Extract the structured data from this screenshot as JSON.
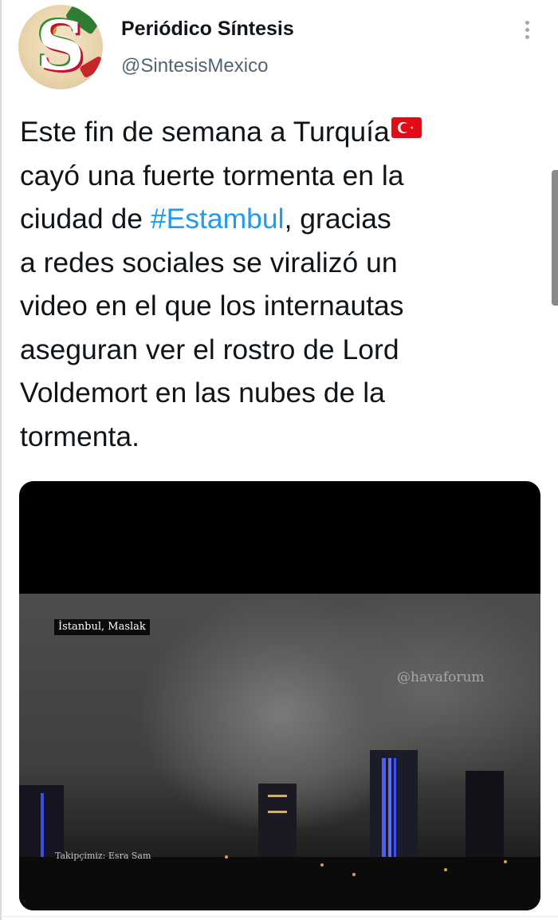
{
  "account": {
    "display_name": "Periódico Síntesis",
    "handle": "@SintesisMexico",
    "avatar_icon": "sintesis-logo-icon"
  },
  "tweet": {
    "line1": "Este fin de semana a Turquía",
    "line2": "cayó una fuerte tormenta en la",
    "line3_prefix": "ciudad de ",
    "hashtag": "#Estambul",
    "line3_suffix": ", gracias",
    "line4": "a redes sociales se viralizó un",
    "line5": "video en el que los internautas",
    "line6": "aseguran ver el rostro de Lord",
    "line7": "Voldemort en las nubes de la",
    "line8": "tormenta.",
    "flag_icon": "turkey-flag-icon",
    "hashtag_color": "#1d9bf0"
  },
  "media": {
    "location_label": "İstanbul, Maslak",
    "watermark": "@havaforum",
    "credit": "Takipçimiz: Esra Sam"
  },
  "menu": {
    "icon": "more-vertical-icon"
  }
}
